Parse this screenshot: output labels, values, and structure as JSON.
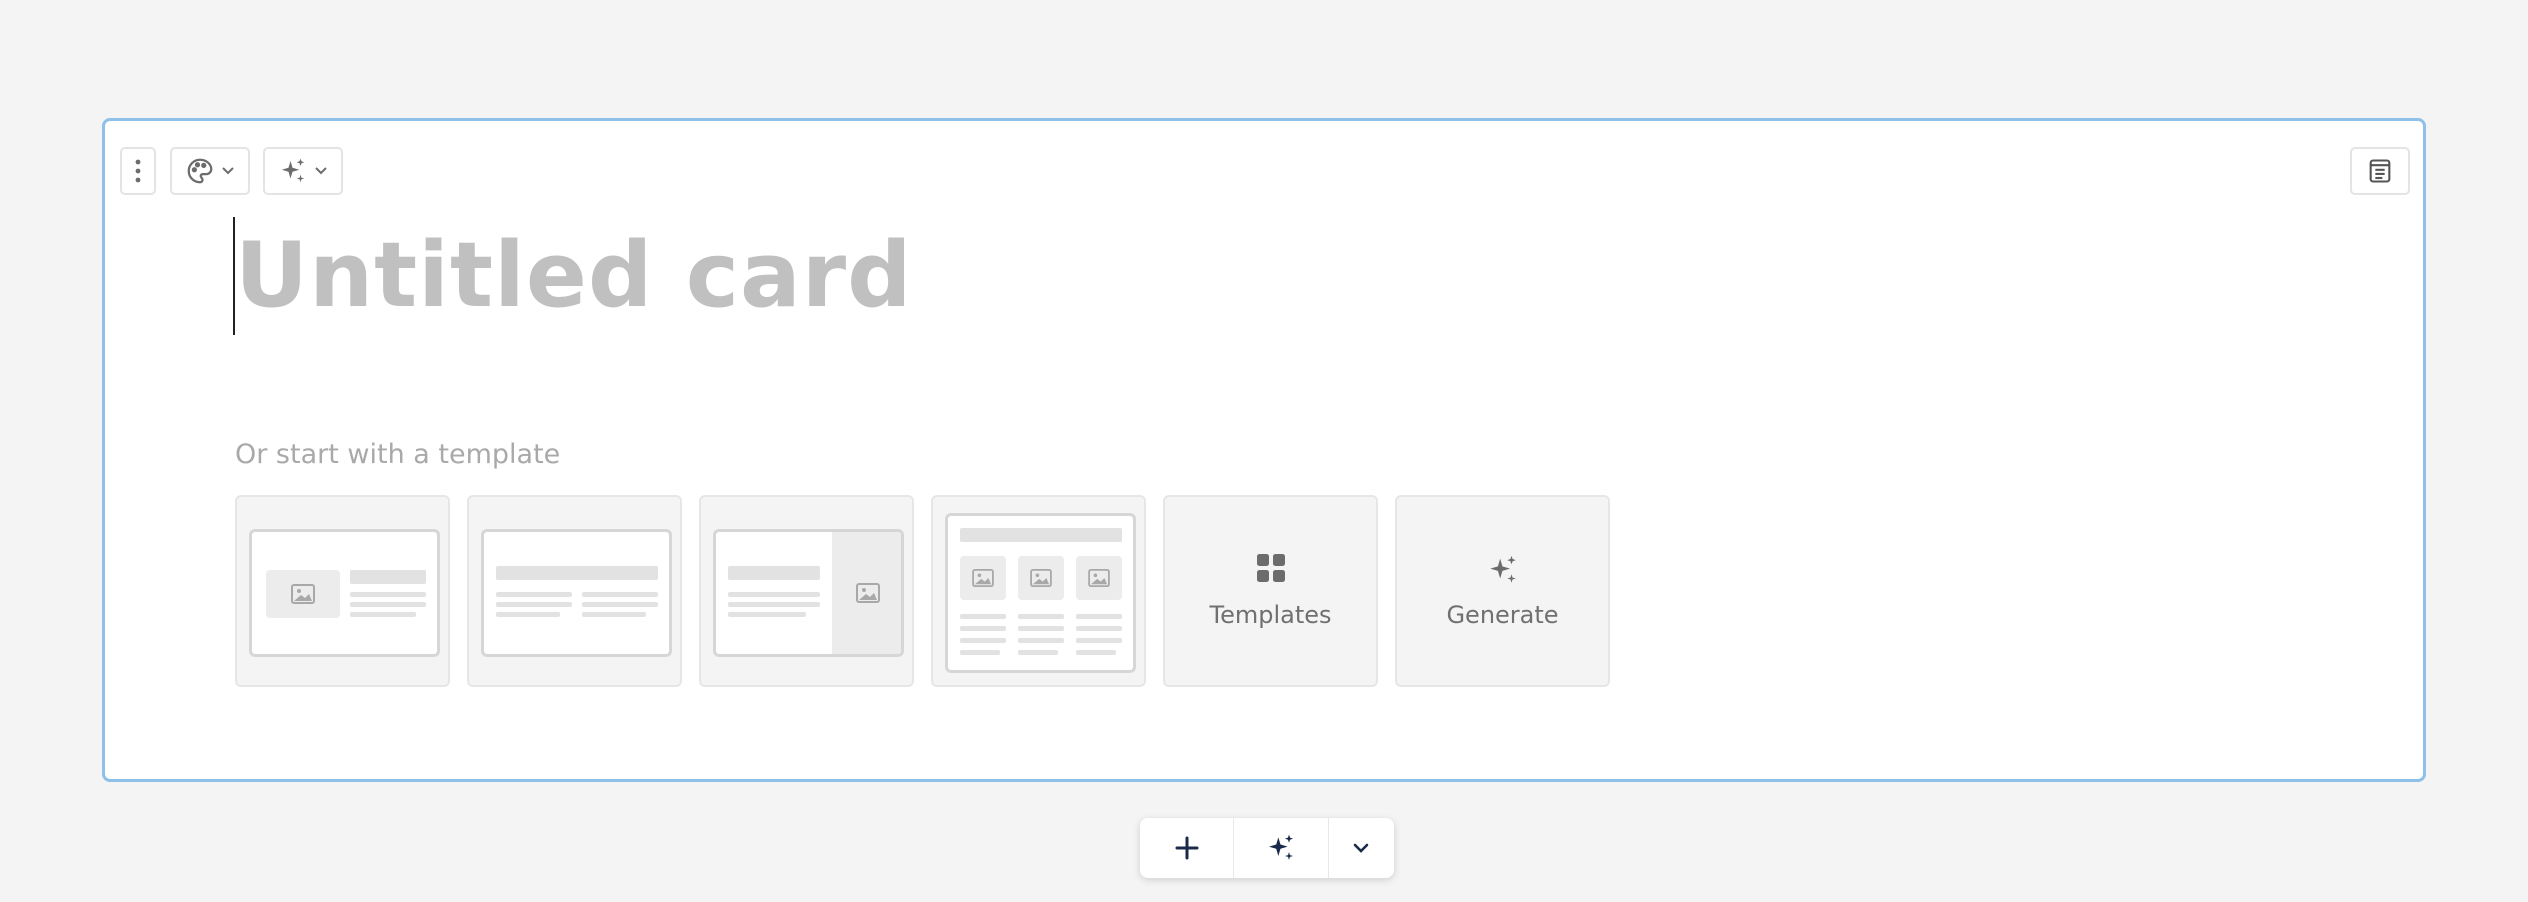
{
  "card": {
    "title_placeholder": "Untitled card",
    "template_prompt": "Or start with a template"
  },
  "tiles": [
    {
      "name": "template-image-left-layout"
    },
    {
      "name": "template-two-column-layout"
    },
    {
      "name": "template-image-right-layout"
    },
    {
      "name": "template-three-images-layout"
    },
    {
      "name": "templates-tile",
      "label": "Templates",
      "icon": "grid-icon"
    },
    {
      "name": "generate-tile",
      "label": "Generate",
      "icon": "sparkles-icon"
    }
  ],
  "toolbar": {
    "items": [
      "more-options-icon",
      "palette-icon",
      "sparkles-icon",
      "notes-icon"
    ]
  },
  "colors": {
    "card_border": "#8ec0ea",
    "background": "#f4f4f4",
    "accent_dark": "#1a2a4a"
  }
}
